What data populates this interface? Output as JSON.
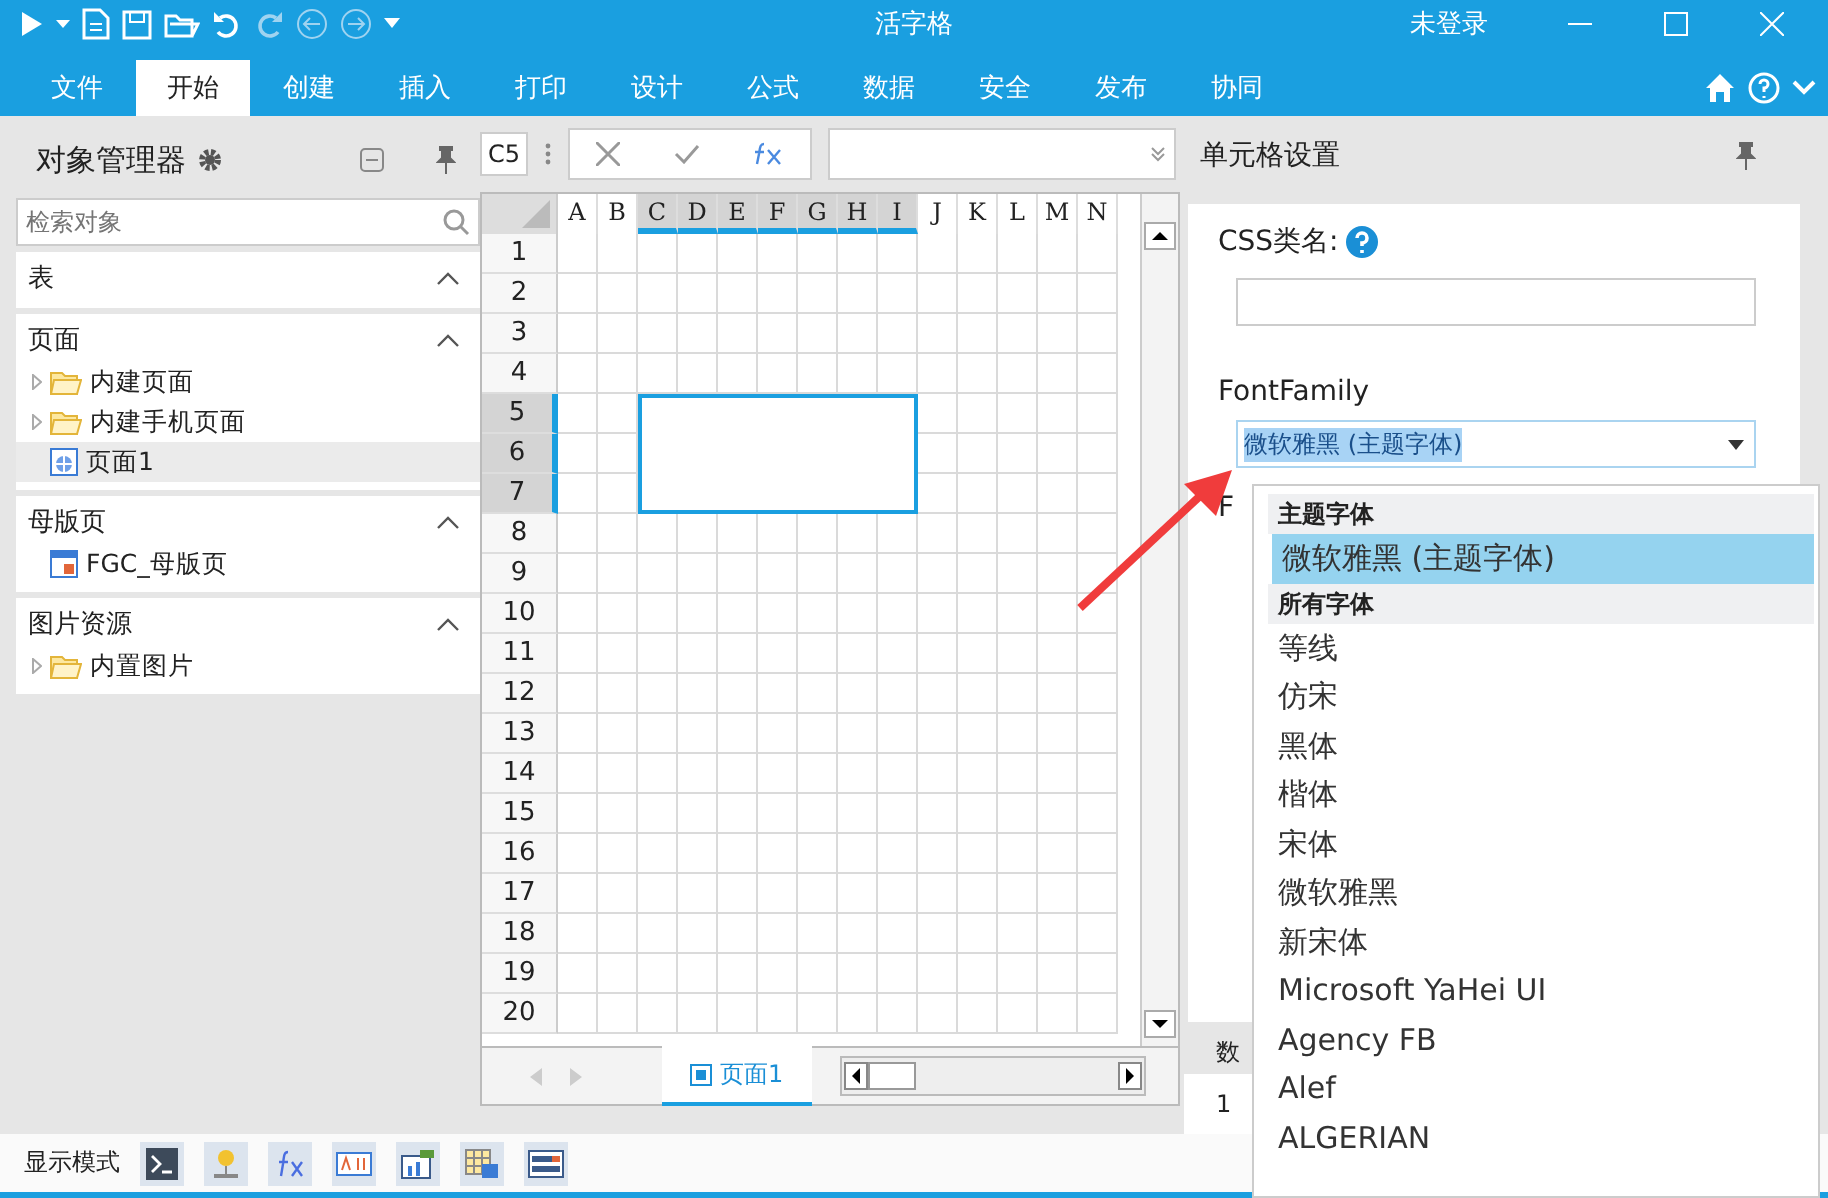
{
  "titlebar": {
    "title": "活字格",
    "user": "未登录"
  },
  "ribbon_tabs": [
    {
      "label": "文件",
      "selected": false
    },
    {
      "label": "开始",
      "selected": true
    },
    {
      "label": "创建",
      "selected": false
    },
    {
      "label": "插入",
      "selected": false
    },
    {
      "label": "打印",
      "selected": false
    },
    {
      "label": "设计",
      "selected": false
    },
    {
      "label": "公式",
      "selected": false
    },
    {
      "label": "数据",
      "selected": false
    },
    {
      "label": "安全",
      "selected": false
    },
    {
      "label": "发布",
      "selected": false
    },
    {
      "label": "协同",
      "selected": false
    }
  ],
  "object_manager": {
    "title": "对象管理器",
    "search": {
      "placeholder": "检索对象"
    },
    "sections": [
      {
        "title": "表",
        "expanded": true
      },
      {
        "title": "页面",
        "expanded": true,
        "items": [
          {
            "label": "内建页面",
            "kind": "folder",
            "selected": false
          },
          {
            "label": "内建手机页面",
            "kind": "folder",
            "selected": false
          },
          {
            "label": "页面1",
            "kind": "page",
            "selected": true
          }
        ]
      },
      {
        "title": "母版页",
        "expanded": true,
        "items": [
          {
            "label": "FGC_母版页",
            "kind": "master",
            "selected": false
          }
        ]
      },
      {
        "title": "图片资源",
        "expanded": true,
        "items": [
          {
            "label": "内置图片",
            "kind": "folder",
            "selected": false
          }
        ]
      }
    ]
  },
  "formula_bar": {
    "cell": "C5"
  },
  "sheet": {
    "columns": [
      {
        "label": "A",
        "selected": false
      },
      {
        "label": "B",
        "selected": false
      },
      {
        "label": "C",
        "selected": true
      },
      {
        "label": "D",
        "selected": true
      },
      {
        "label": "E",
        "selected": true
      },
      {
        "label": "F",
        "selected": true
      },
      {
        "label": "G",
        "selected": true
      },
      {
        "label": "H",
        "selected": true
      },
      {
        "label": "I",
        "selected": true
      },
      {
        "label": "J",
        "selected": false
      },
      {
        "label": "K",
        "selected": false
      },
      {
        "label": "L",
        "selected": false
      },
      {
        "label": "M",
        "selected": false
      },
      {
        "label": "N",
        "selected": false
      }
    ],
    "rows": [
      {
        "label": "1",
        "selected": false
      },
      {
        "label": "2",
        "selected": false
      },
      {
        "label": "3",
        "selected": false
      },
      {
        "label": "4",
        "selected": false
      },
      {
        "label": "5",
        "selected": true
      },
      {
        "label": "6",
        "selected": true
      },
      {
        "label": "7",
        "selected": true
      },
      {
        "label": "8",
        "selected": false
      },
      {
        "label": "9",
        "selected": false
      },
      {
        "label": "10",
        "selected": false
      },
      {
        "label": "11",
        "selected": false
      },
      {
        "label": "12",
        "selected": false
      },
      {
        "label": "13",
        "selected": false
      },
      {
        "label": "14",
        "selected": false
      },
      {
        "label": "15",
        "selected": false
      },
      {
        "label": "16",
        "selected": false
      },
      {
        "label": "17",
        "selected": false
      },
      {
        "label": "18",
        "selected": false
      },
      {
        "label": "19",
        "selected": false
      },
      {
        "label": "20",
        "selected": false
      }
    ],
    "sheet_tab": "页面1"
  },
  "cell_settings": {
    "title": "单元格设置",
    "css_label": "CSS类名:",
    "font_family_label": "FontFamily",
    "font_family_value": "微软雅黑 (主题字体)",
    "cut_label": "F",
    "cut_footer": "数",
    "cut_value": "1"
  },
  "font_dropdown": {
    "groups": [
      {
        "header": "主题字体",
        "fonts": [
          {
            "name": "微软雅黑 (主题字体)",
            "selected": true
          }
        ]
      },
      {
        "header": "所有字体",
        "fonts": [
          {
            "name": "等线",
            "selected": false
          },
          {
            "name": "仿宋",
            "selected": false
          },
          {
            "name": "黑体",
            "selected": false
          },
          {
            "name": "楷体",
            "selected": false
          },
          {
            "name": "宋体",
            "selected": false
          },
          {
            "name": "微软雅黑",
            "selected": false
          },
          {
            "name": "新宋体",
            "selected": false
          },
          {
            "name": "Microsoft YaHei UI",
            "selected": false
          },
          {
            "name": "Agency FB",
            "selected": false
          },
          {
            "name": "Alef",
            "selected": false
          },
          {
            "name": "ALGERIAN",
            "selected": false
          }
        ]
      }
    ]
  },
  "status_bar": {
    "label": "显示模式"
  }
}
